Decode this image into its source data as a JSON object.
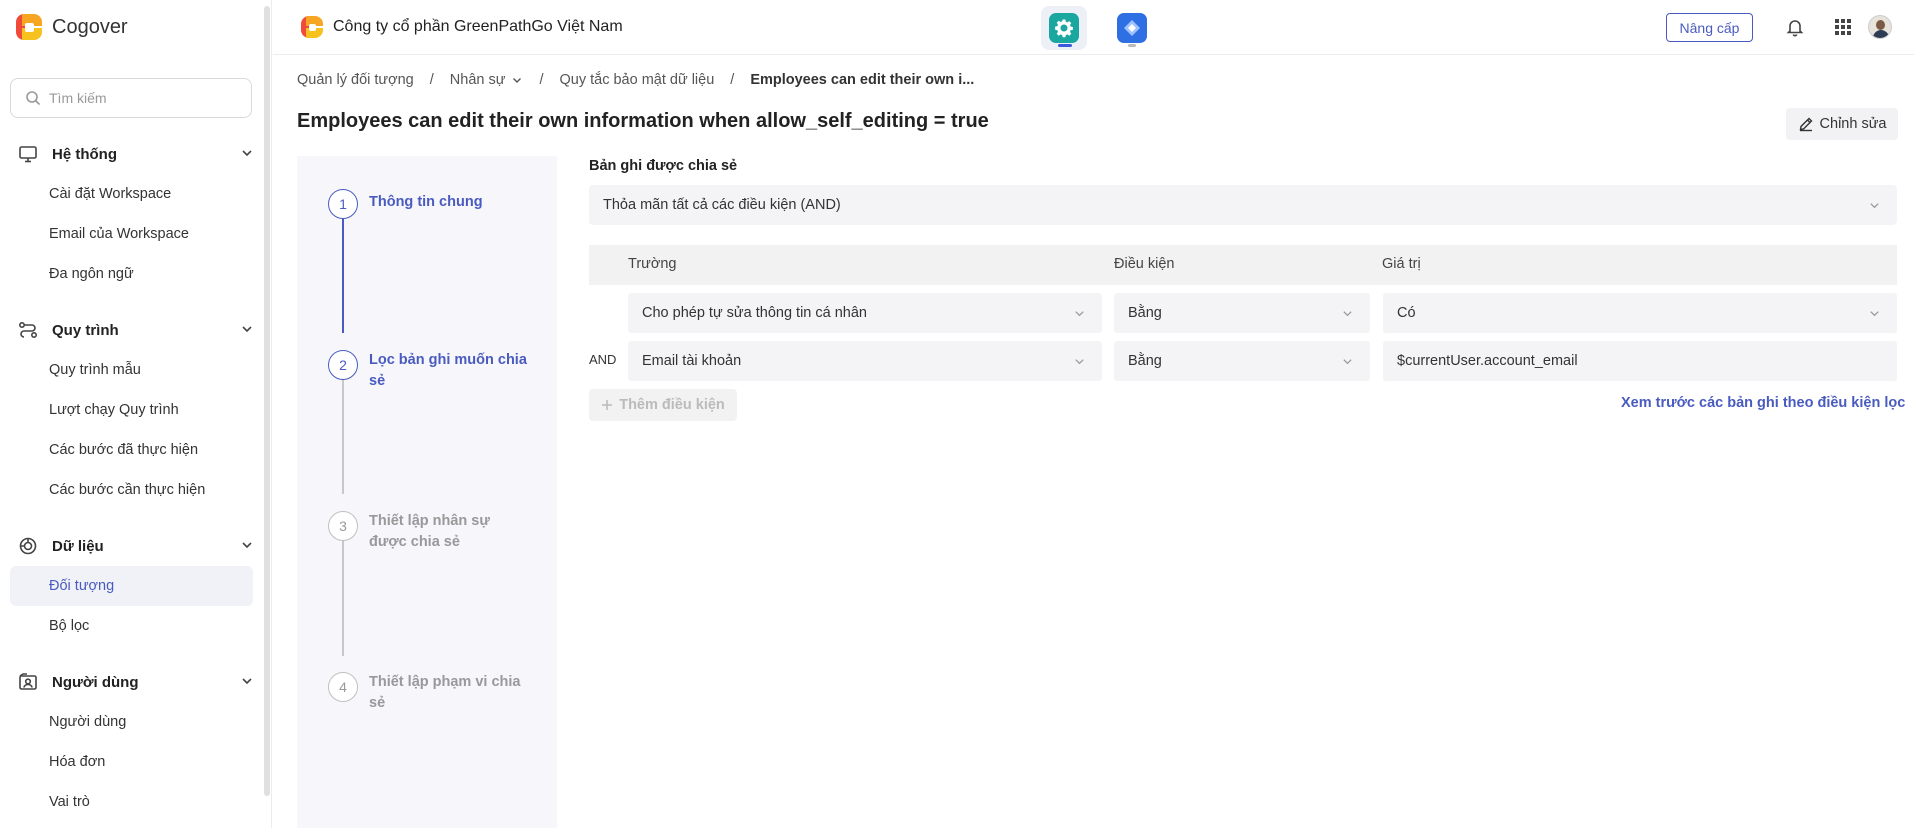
{
  "sidebar": {
    "brand": "Cogover",
    "search_placeholder": "Tìm kiếm",
    "groups": [
      {
        "title": "Hệ thống",
        "icon": "monitor-icon",
        "items": [
          "Cài đặt Workspace",
          "Email của Workspace",
          "Đa ngôn ngữ"
        ]
      },
      {
        "title": "Quy trình",
        "icon": "workflow-icon",
        "items": [
          "Quy trình mẫu",
          "Lượt chạy Quy trình",
          "Các bước đã thực hiện",
          "Các bước cần thực hiện"
        ]
      },
      {
        "title": "Dữ liệu",
        "icon": "data-icon",
        "items": [
          "Đối tượng",
          "Bộ lọc"
        ]
      },
      {
        "title": "Người dùng",
        "icon": "users-icon",
        "items": [
          "Người dùng",
          "Hóa đơn",
          "Vai trò"
        ]
      }
    ],
    "active_item": "Đối tượng"
  },
  "topbar": {
    "company": "Công ty cổ phần GreenPathGo Việt Nam",
    "apps": [
      "settings-app-icon",
      "workflow-app-icon"
    ],
    "upgrade_label": "Nâng cấp",
    "icons": [
      "bell-icon",
      "apps-grid-icon",
      "avatar"
    ]
  },
  "breadcrumb": {
    "items": [
      "Quản lý đối tượng",
      "Nhân sự",
      "Quy tắc bảo mật dữ liệu",
      "Employees can edit their own i..."
    ]
  },
  "page": {
    "title": "Employees can edit their own information when allow_self_editing = true",
    "edit_label": "Chỉnh sửa"
  },
  "steps": [
    {
      "number": "1",
      "label": "Thông tin chung",
      "state": "active"
    },
    {
      "number": "2",
      "label": "Lọc bản ghi muốn chia sẻ",
      "state": "active"
    },
    {
      "number": "3",
      "label": "Thiết lập nhân sự được chia sẻ",
      "state": "inactive"
    },
    {
      "number": "4",
      "label": "Thiết lập phạm vi chia sẻ",
      "state": "inactive"
    }
  ],
  "filter": {
    "section_label": "Bản ghi được chia sẻ",
    "match_mode": "Thỏa mãn tất cả các điều kiện (AND)",
    "columns": [
      "Trường",
      "Điều kiện",
      "Giá trị"
    ],
    "rows": [
      {
        "connector": "",
        "field": "Cho phép tự sửa thông tin cá nhân",
        "operator": "Bằng",
        "value": "Có"
      },
      {
        "connector": "AND",
        "field": "Email tài khoản",
        "operator": "Bằng",
        "value": "$currentUser.account_email"
      }
    ],
    "add_condition_label": "Thêm điều kiện",
    "preview_link": "Xem trước các bản ghi theo điều kiện lọc"
  },
  "colors": {
    "accent": "#4a5bc0",
    "settings_app": "#19a7a0",
    "workflow_app": "#2f6fe4",
    "step_panel_bg": "#f6f6fb"
  }
}
